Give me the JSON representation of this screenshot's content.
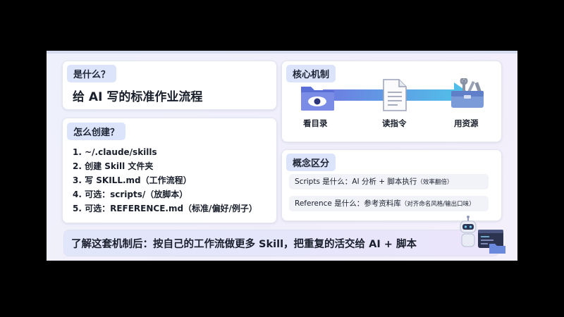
{
  "what": {
    "label": "是什么？",
    "text": "给 AI 写的标准作业流程"
  },
  "how": {
    "label": "怎么创建？",
    "steps": [
      "1. ~/.claude/skills",
      "2. 创建 Skill 文件夹",
      "3. 写 SKILL.md（工作流程）",
      "4. 可选：scripts/（放脚本）",
      "5. 可选：REFERENCE.md（标准/偏好/例子）"
    ]
  },
  "mechanism": {
    "label": "核心机制",
    "stages": [
      {
        "icon": "folder-eye-icon",
        "caption": "看目录"
      },
      {
        "icon": "document-icon",
        "caption": "读指令"
      },
      {
        "icon": "toolbox-icon",
        "caption": "用资源"
      }
    ]
  },
  "concepts": {
    "label": "概念区分",
    "rows": [
      {
        "main": "Scripts 是什么：AI 分析 + 脚本执行",
        "note": "（效率翻倍）"
      },
      {
        "main": "Reference 是什么：参考资料库",
        "note": "（对齐命名风格/输出口味）"
      }
    ]
  },
  "banner": {
    "text": "了解这套机制后：按自己的工作流做更多 Skill，把重复的活交给 AI + 脚本"
  },
  "colors": {
    "pill_bg": "#dbe4fb",
    "accent_cyan": "#4ec6ea",
    "icon_blue": "#5a6fd8"
  }
}
